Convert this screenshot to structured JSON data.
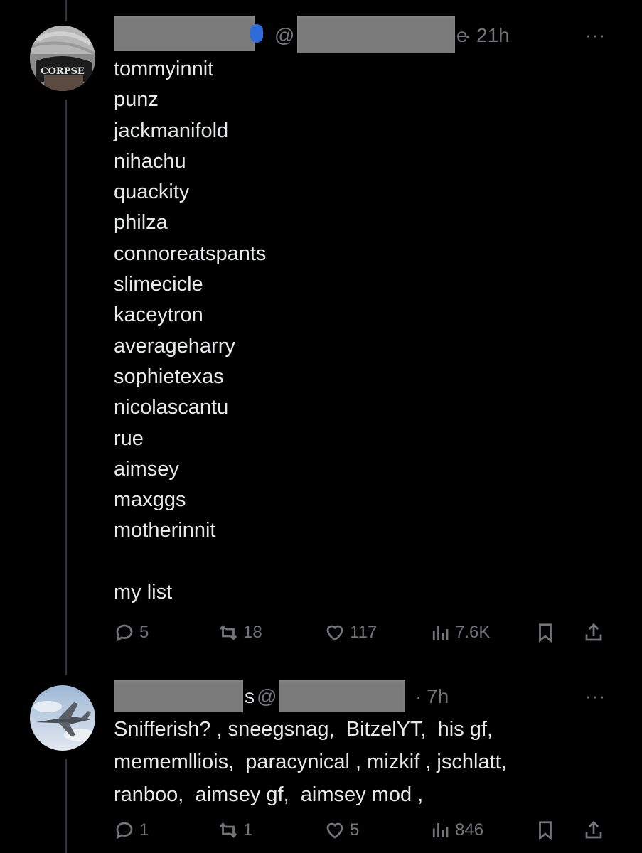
{
  "tweets": [
    {
      "handle_prefix": "@",
      "handle_tail": "e",
      "time": "21h",
      "more_label": "···",
      "avatar_text": "CORPSE",
      "lines": [
        "tommyinnit",
        "punz",
        "jackmanifold",
        "nihachu",
        "quackity",
        "philza",
        "connoreatspants",
        "slimecicle",
        "kaceytron",
        "averageharry",
        "sophietexas",
        "nicolascantu",
        "rue",
        "aimsey",
        "maxggs",
        "motherinnit",
        "",
        "my list"
      ],
      "replies": "5",
      "retweets": "18",
      "likes": "117",
      "views": "7.6K"
    },
    {
      "name_tail": "s",
      "handle_prefix": "@",
      "time": "7h",
      "more_label": "···",
      "text": "Snifferish? , sneegsnag,  BitzelYT,  his gf,\nmememlliois,  paracynical , mizkif , jschlatt,\nranboo,  aimsey gf,  aimsey mod ,",
      "replies": "1",
      "retweets": "1",
      "likes": "5",
      "views": "846"
    }
  ],
  "icons": [
    "reply-icon",
    "retweet-icon",
    "like-icon",
    "views-icon",
    "bookmark-icon",
    "share-icon"
  ],
  "colors": {
    "background": "#000000",
    "text": "#e7e9ea",
    "muted": "#71767b",
    "verified": "#2f6bd9"
  }
}
